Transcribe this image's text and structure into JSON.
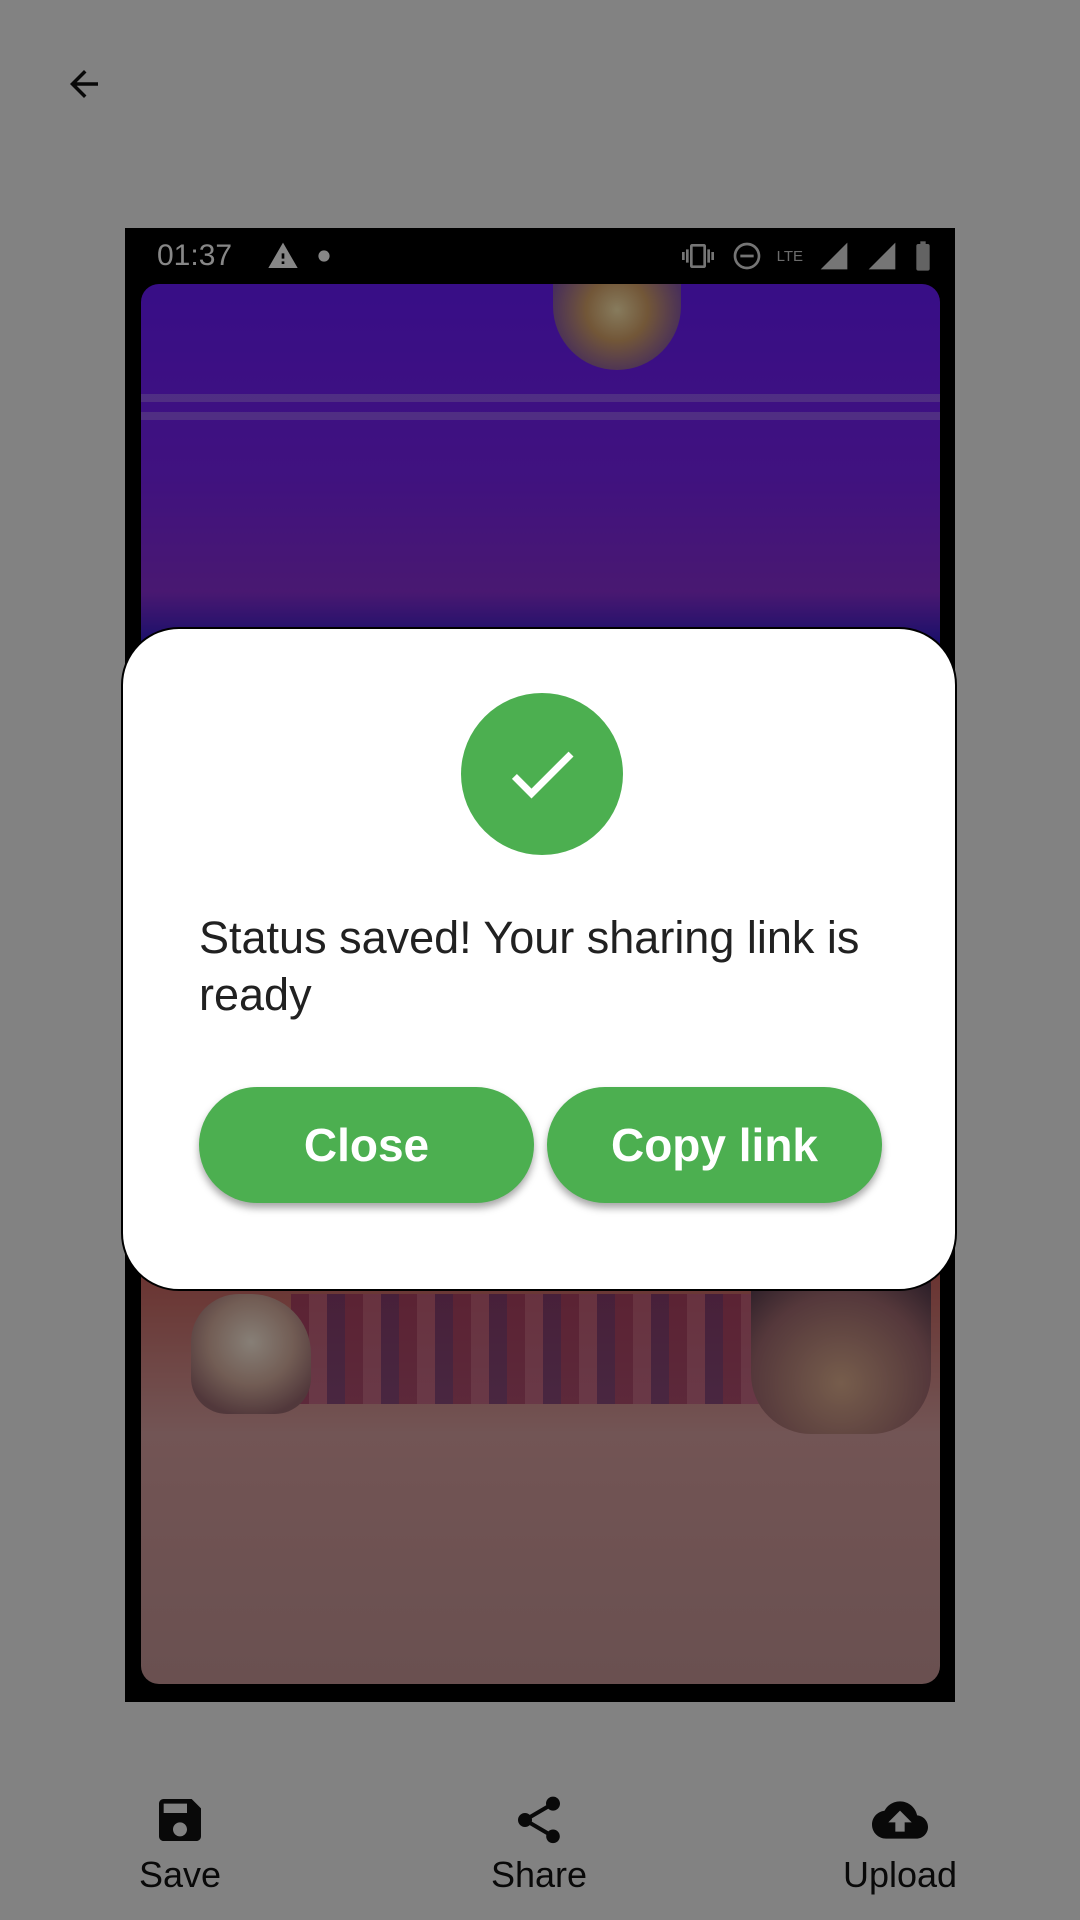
{
  "status_bar": {
    "time": "01:37",
    "network_type": "LTE"
  },
  "dialog": {
    "message": "Status saved! Your sharing link is ready",
    "close_label": "Close",
    "copy_label": "Copy link",
    "accent_color": "#4caf50"
  },
  "bottom_bar": {
    "save_label": "Save",
    "share_label": "Share",
    "upload_label": "Upload"
  },
  "icons": {
    "back": "arrow-back-icon",
    "check": "check-icon",
    "save": "save-icon",
    "share": "share-icon",
    "upload": "cloud-upload-icon"
  }
}
